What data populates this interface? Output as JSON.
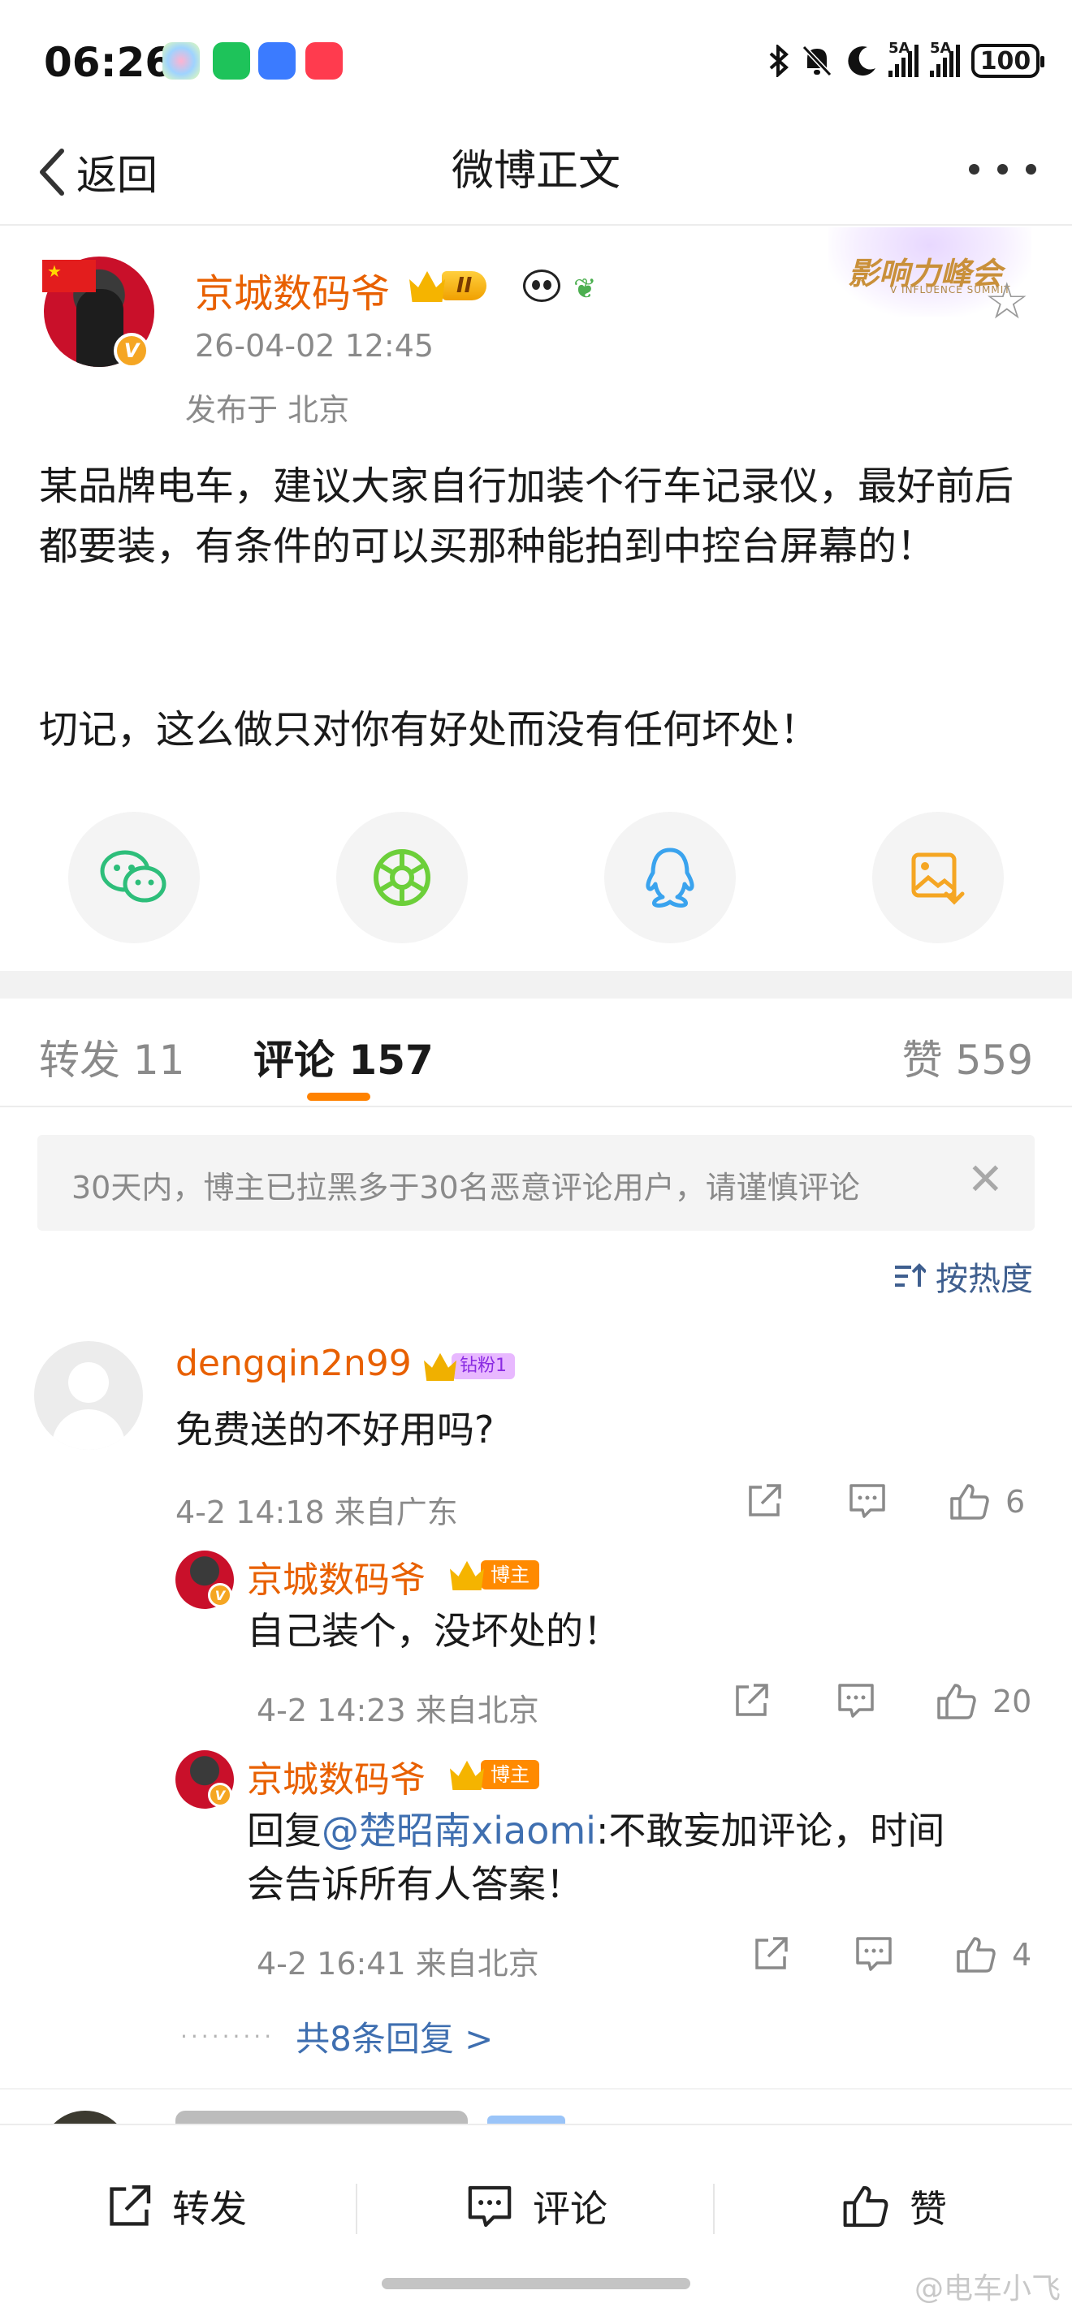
{
  "status_bar": {
    "time": "06:26",
    "signal1_label": "5A",
    "signal2_label": "5A",
    "battery": "100"
  },
  "nav": {
    "back_label": "返回",
    "title": "微博正文"
  },
  "post": {
    "author": "京城数码爷",
    "level_badge": "II",
    "time": "26-04-02 12:45",
    "location": "发布于 北京",
    "summit_label": "影响力峰会",
    "summit_sub": "V INFLUENCE SUMMIT",
    "paragraph1": "某品牌电车，建议大家自行加装个行车记录仪，最好前后都要装，有条件的可以买那种能拍到中控台屏幕的！",
    "paragraph2": "切记，这么做只对你有好处而没有任何坏处！",
    "share_icons": [
      "wechat-icon",
      "moments-icon",
      "qq-icon",
      "save-image-icon"
    ]
  },
  "tabs": {
    "repost": "转发 11",
    "comment": "评论 157",
    "like": "赞 559"
  },
  "notice": {
    "text": "30天内，博主已拉黑多于30名恶意评论用户，请谨慎评论"
  },
  "sort": {
    "label": "按热度"
  },
  "comments": [
    {
      "user": "dengqin2n99",
      "badge": "钻粉1",
      "text": "免费送的不好用吗?",
      "meta": "4-2 14:18 来自广东",
      "likes": "6",
      "replies": [
        {
          "user": "京城数码爷",
          "badge": "博主",
          "text": "自己装个，没坏处的！",
          "meta": "4-2 14:23 来自北京",
          "likes": "20"
        },
        {
          "user": "京城数码爷",
          "badge": "博主",
          "reply_prefix": "回复",
          "mention": "@楚昭南xiaomi",
          "text_line1": ":不敢妄加评论，时间",
          "text_line2": "会告诉所有人答案！",
          "meta": "4-2 16:41 来自北京",
          "likes": "4"
        }
      ],
      "more_replies": "共8条回复 >"
    }
  ],
  "bottom_bar": {
    "repost": "转发",
    "comment": "评论",
    "like": "赞"
  },
  "watermark": "@电车小飞",
  "colors": {
    "accent_orange": "#ff8200",
    "username_orange": "#e86000",
    "link_blue": "#3f6fb0",
    "muted_gray": "#8a8a8a"
  }
}
